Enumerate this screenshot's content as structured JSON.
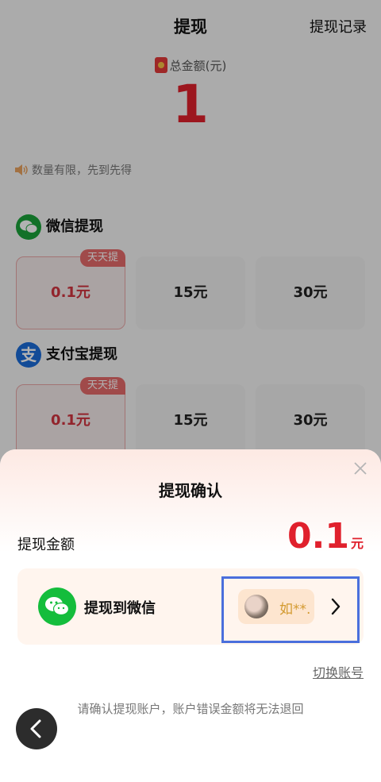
{
  "header": {
    "title": "提现",
    "record_link": "提现记录"
  },
  "total": {
    "label": "总金额(元)",
    "amount": "1"
  },
  "notice": {
    "text": "数量有限，先到先得"
  },
  "wechat_section": {
    "title": "微信提现",
    "tag": "天天提",
    "options": [
      "0.1元",
      "15元",
      "30元"
    ]
  },
  "alipay_section": {
    "title": "支付宝提现",
    "icon_char": "支",
    "tag": "天天提",
    "options": [
      "0.1元",
      "15元",
      "30元"
    ]
  },
  "sheet": {
    "title": "提现确认",
    "amount_label": "提现金额",
    "amount_value": "0.1",
    "amount_unit": "元",
    "account_label": "提现到微信",
    "username": "如**.",
    "switch_account": "切换账号",
    "warning": "请确认提现账户，账户错误金额将无法退回"
  },
  "icons": [
    "red-envelope-icon",
    "speaker-icon",
    "wechat-icon",
    "alipay-icon",
    "close-icon",
    "chevron-right-icon",
    "back-arrow-icon"
  ],
  "colors": {
    "accent_red": "#e0202c",
    "wechat_green": "#14bd3c",
    "alipay_blue": "#1a6cd8",
    "highlight_blue": "#4a6fdc"
  }
}
